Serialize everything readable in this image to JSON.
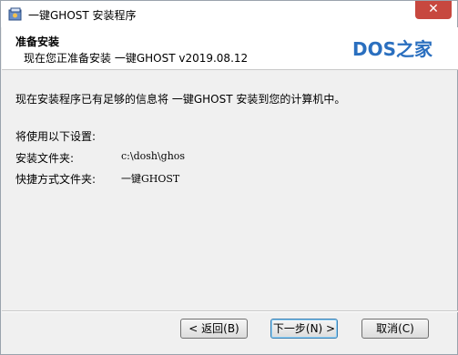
{
  "window": {
    "title": "一键GHOST 安装程序",
    "close_label": "✕"
  },
  "header": {
    "title": "准备安装",
    "subtitle": "现在您正准备安装 一键GHOST v2019.08.12",
    "logo_text": "DOS之家",
    "logo_color": "#2a6fbf"
  },
  "content": {
    "intro": "现在安装程序已有足够的信息将 一键GHOST 安装到您的计算机中。",
    "settings_heading": "将使用以下设置:",
    "settings": [
      {
        "label": "安装文件夹:",
        "value": "c:\\dosh\\ghos"
      },
      {
        "label": "快捷方式文件夹:",
        "value": "一键GHOST"
      }
    ]
  },
  "buttons": {
    "back": "< 返回(B)",
    "next": "下一步(N) >",
    "cancel": "取消(C)"
  }
}
